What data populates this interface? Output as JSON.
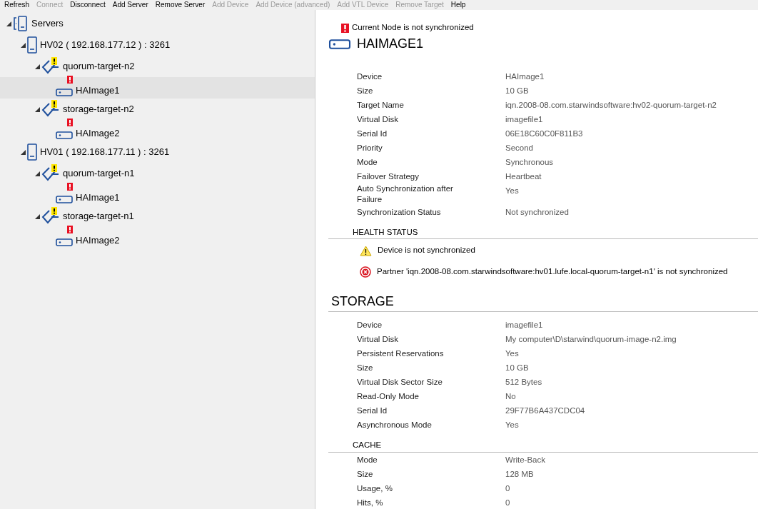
{
  "toolbar": [
    {
      "label": "Refresh",
      "disabled": false
    },
    {
      "label": "Connect",
      "disabled": true
    },
    {
      "label": "Disconnect",
      "disabled": false
    },
    {
      "label": "Add Server",
      "disabled": false
    },
    {
      "label": "Remove Server",
      "disabled": false
    },
    {
      "label": "Add Device",
      "disabled": true
    },
    {
      "label": "Add Device (advanced)",
      "disabled": true
    },
    {
      "label": "Add VTL Device",
      "disabled": true
    },
    {
      "label": "Remove Target",
      "disabled": true
    },
    {
      "label": "Help",
      "disabled": false
    }
  ],
  "tree": [
    {
      "kind": "root",
      "label": "Servers",
      "expanded": true,
      "selected": false,
      "children": [
        {
          "kind": "server",
          "label": "HV02 ( 192.168.177.12 ) : 3261",
          "expanded": true,
          "selected": false,
          "children": [
            {
              "kind": "target",
              "label": "quorum-target-n2",
              "color": "#ffe600",
              "expanded": true,
              "selected": false,
              "children": [
                {
                  "kind": "device",
                  "label": "HAImage1",
                  "color": "#e81123",
                  "selected": true
                }
              ]
            },
            {
              "kind": "target",
              "label": "storage-target-n2",
              "color": "#ffe600",
              "expanded": true,
              "selected": false,
              "children": [
                {
                  "kind": "device",
                  "label": "HAImage2",
                  "color": "#e81123",
                  "selected": false
                }
              ]
            }
          ]
        },
        {
          "kind": "server",
          "label": "HV01 ( 192.168.177.11 ) : 3261",
          "expanded": true,
          "selected": false,
          "children": [
            {
              "kind": "target",
              "label": "quorum-target-n1",
              "color": "#ffe600",
              "expanded": true,
              "selected": false,
              "children": [
                {
                  "kind": "device",
                  "label": "HAImage1",
                  "color": "#e81123",
                  "selected": false
                }
              ]
            },
            {
              "kind": "target",
              "label": "storage-target-n1",
              "color": "#ffe600",
              "expanded": true,
              "selected": false,
              "children": [
                {
                  "kind": "device",
                  "label": "HAImage2",
                  "color": "#e81123",
                  "selected": false
                }
              ]
            }
          ]
        }
      ]
    }
  ],
  "detail": {
    "alert": "Current Node is not synchronized",
    "title": "HAIMAGE1",
    "properties": [
      [
        "Device",
        "HAImage1"
      ],
      [
        "Size",
        "10 GB"
      ],
      [
        "Target Name",
        "iqn.2008-08.com.starwindsoftware:hv02-quorum-target-n2"
      ],
      [
        "Virtual Disk",
        "imagefile1"
      ],
      [
        "Serial Id",
        "06E18C60C0F811B3"
      ],
      [
        "Priority",
        "Second"
      ],
      [
        "Mode",
        "Synchronous"
      ],
      [
        "Failover Strategy",
        "Heartbeat"
      ],
      [
        "Auto Synchronization after Failure",
        "Yes"
      ],
      [
        "Synchronization Status",
        "Not synchronized"
      ]
    ],
    "health_title": "HEALTH STATUS",
    "health": [
      {
        "kind": "warning",
        "text": "Device is not synchronized"
      },
      {
        "kind": "error",
        "text": "Partner 'iqn.2008-08.com.starwindsoftware:hv01.lufe.local-quorum-target-n1' is not synchronized"
      }
    ],
    "storage_title": "STORAGE",
    "storage": [
      [
        "Device",
        "imagefile1"
      ],
      [
        "Virtual Disk",
        "My computer\\D\\starwind\\quorum-image-n2.img"
      ],
      [
        "Persistent Reservations",
        "Yes"
      ],
      [
        "Size",
        "10 GB"
      ],
      [
        "Virtual Disk Sector Size",
        "512 Bytes"
      ],
      [
        "Read-Only Mode",
        "No"
      ],
      [
        "Serial Id",
        "29F77B6A437CDC04"
      ],
      [
        "Asynchronous Mode",
        "Yes"
      ]
    ],
    "cache_title": "CACHE",
    "cache": [
      [
        "Mode",
        "Write-Back"
      ],
      [
        "Size",
        "128 MB"
      ],
      [
        "Usage, %",
        "0"
      ],
      [
        "Hits, %",
        "0"
      ]
    ]
  }
}
